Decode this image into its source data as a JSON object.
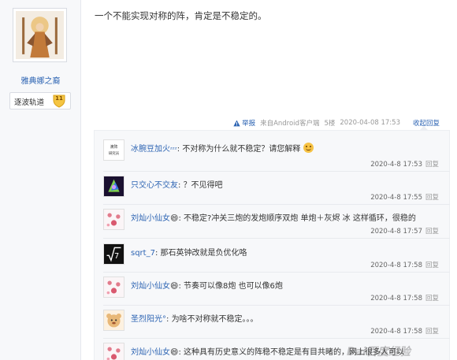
{
  "user": {
    "name": "雅典娜之裔",
    "badge_label": "逐波轨道",
    "badge_level": "11"
  },
  "post": {
    "text": "一个不能实现对称的阵，肯定是不稳定的。",
    "report": "举报",
    "source": "来自Android客户端",
    "floor": "5楼",
    "time": "2020-04-08 17:53",
    "collapse": "收起回复"
  },
  "reply_action": "回复",
  "replies": [
    {
      "name": "冰腕豆加火",
      "text": "不对称为什么就不稳定？请您解释",
      "time": "2020-4-8 17:53"
    },
    {
      "name": "只交心不交友",
      "text": "？不见得吧",
      "time": "2020-4-8 17:55"
    },
    {
      "name": "刘灿小仙女",
      "text": "不稳定?冲关三炮的发炮顺序双炮 单炮＋灰烬 冰 这样循环，很稳的",
      "time": "2020-4-8 17:57"
    },
    {
      "name": "sqrt_7",
      "text": "那石英钟改就是负优化咯",
      "time": "2020-4-8 17:58"
    },
    {
      "name": "刘灿小仙女",
      "text": "节奏可以像8炮 也可以像6炮",
      "time": "2020-4-8 17:58"
    },
    {
      "name": "圣烈阳光°",
      "text": "为啥不对称就不稳定。。。",
      "time": "2020-4-8 17:58"
    },
    {
      "name": "刘灿小仙女",
      "text": "这种具有历史意义的阵稳不稳定是有目共睹的，网上很多人可以",
      "time": ""
    }
  ],
  "colors": {
    "link": "#2d64b3",
    "meta": "#999999",
    "panel": "#f7f8fa"
  },
  "watermark": "Bai百度经验"
}
